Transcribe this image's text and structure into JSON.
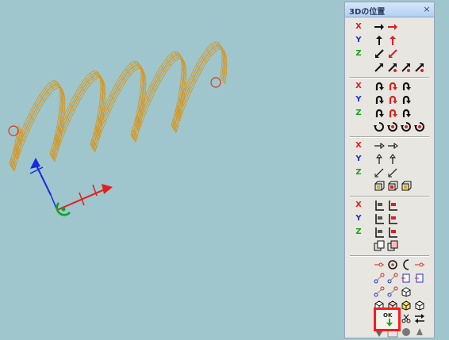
{
  "panel": {
    "title": "3Dの位置",
    "close_glyph": "×",
    "axis_labels": {
      "x": "X",
      "y": "Y",
      "z": "Z"
    },
    "ok_label": "OK"
  },
  "colors": {
    "background": "#9ec6cc",
    "spring_wire": "#d8961e",
    "endpoint": "#e03020",
    "gizmo_x": "#e02020",
    "gizmo_y": "#1a2ae0",
    "gizmo_z": "#10a030",
    "ok_highlight": "#ff1a1a"
  },
  "tool_groups": [
    {
      "name": "move",
      "rows": [
        {
          "axis": "x",
          "icons": [
            "move-x-icon",
            "move-x-red-icon"
          ]
        },
        {
          "axis": "y",
          "icons": [
            "move-y-icon",
            "move-y-red-icon"
          ]
        },
        {
          "axis": "z",
          "icons": [
            "move-z-icon",
            "move-z-red-icon"
          ]
        },
        {
          "axis": "",
          "icons": [
            "move-diag-icon",
            "move-diag-a-icon",
            "move-diag-b-icon",
            "move-diag-c-icon"
          ]
        }
      ]
    },
    {
      "name": "rotate",
      "rows": [
        {
          "axis": "x",
          "icons": [
            "rotate-x-icon",
            "rotate-x-red-icon",
            "rotate-x-alt-icon"
          ]
        },
        {
          "axis": "y",
          "icons": [
            "rotate-y-icon",
            "rotate-y-red-icon",
            "rotate-y-alt-icon"
          ]
        },
        {
          "axis": "z",
          "icons": [
            "rotate-z-icon",
            "rotate-z-red-icon",
            "rotate-z-alt-icon"
          ]
        },
        {
          "axis": "",
          "icons": [
            "rotate-free-icon",
            "rotate-free-a-icon",
            "rotate-free-b-icon",
            "rotate-free-c-icon"
          ]
        }
      ]
    },
    {
      "name": "offset",
      "rows": [
        {
          "axis": "x",
          "icons": [
            "offset-x-icon",
            "offset-x-axis-icon"
          ]
        },
        {
          "axis": "y",
          "icons": [
            "offset-y-icon",
            "offset-y-axis-icon"
          ]
        },
        {
          "axis": "z",
          "icons": [
            "offset-z-icon",
            "offset-z-axis-icon"
          ]
        },
        {
          "axis": "",
          "icons": [
            "box-move-icon",
            "box-move-red-icon",
            "box-origin-icon"
          ]
        }
      ]
    },
    {
      "name": "align",
      "rows": [
        {
          "axis": "x",
          "icons": [
            "align-x-icon",
            "align-x-red-icon"
          ]
        },
        {
          "axis": "y",
          "icons": [
            "align-y-icon",
            "align-y-red-icon"
          ]
        },
        {
          "axis": "z",
          "icons": [
            "align-z-icon",
            "align-z-red-icon"
          ]
        },
        {
          "axis": "",
          "icons": [
            "copy-icon",
            "copy-red-icon"
          ]
        }
      ]
    },
    {
      "name": "snap",
      "rows": [
        {
          "axis": "",
          "icons": [
            "point-icon",
            "circle-center-icon",
            "arc-icon",
            "line-point-icon"
          ]
        },
        {
          "axis": "",
          "icons": [
            "node-icon",
            "node-red-icon",
            "plane-icon",
            "plane-red-icon"
          ]
        },
        {
          "axis": "",
          "icons": [
            "node-blue-icon",
            "node-multi-icon",
            "cube-small-icon"
          ]
        },
        {
          "axis": "",
          "icons": [
            "cube-icon",
            "cube-red-icon",
            "cube-yellow-icon",
            "cube-outline-icon"
          ]
        },
        {
          "axis": "",
          "icons": [
            "triangle-icon",
            "cube-gold-icon",
            "scissor-icon",
            "arrows-icon"
          ]
        },
        {
          "axis": "",
          "icons": [
            "triangle-down-icon",
            "ok-icon",
            "disk-icon",
            "shape-icon"
          ]
        }
      ]
    }
  ]
}
